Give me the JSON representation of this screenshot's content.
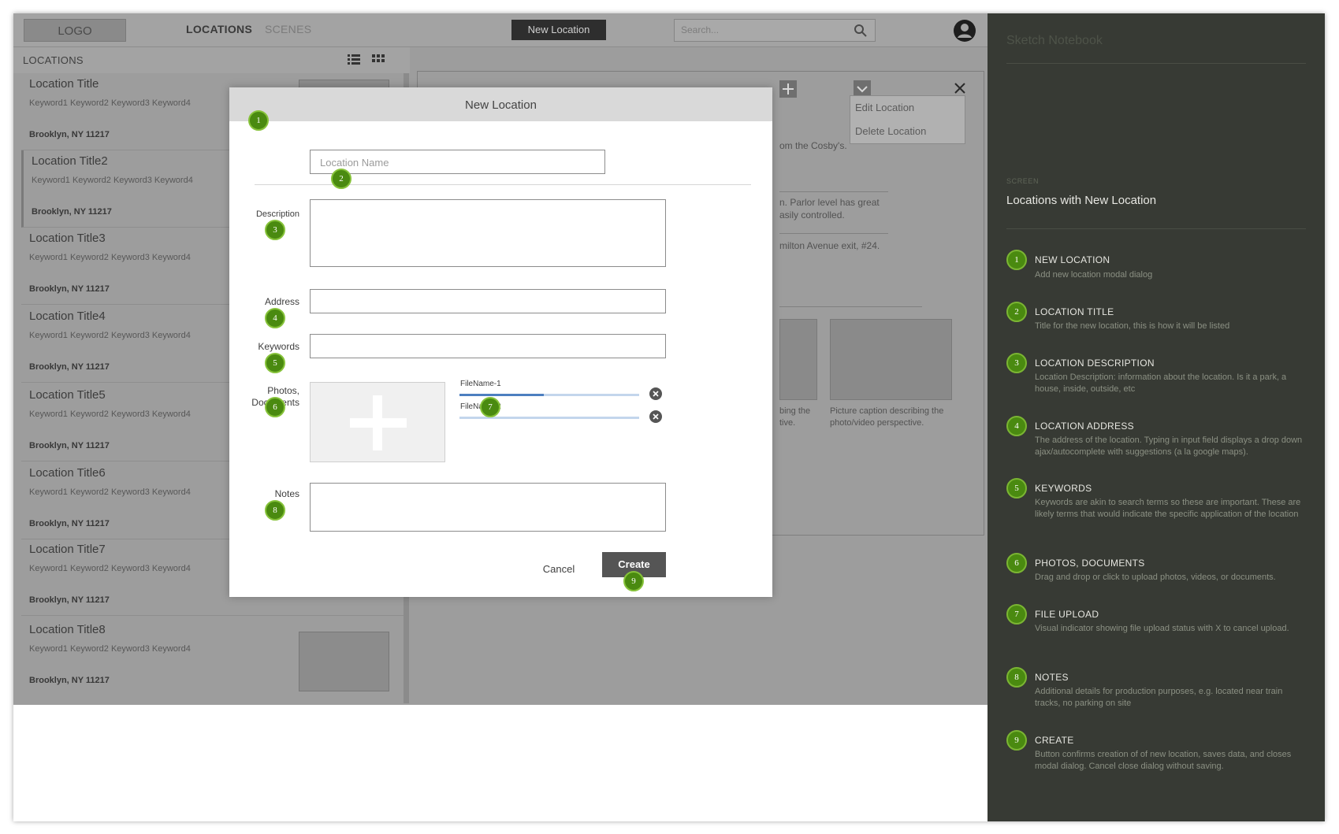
{
  "topbar": {
    "logo": "LOGO",
    "nav_locations": "LOCATIONS",
    "nav_scenes": "SCENES",
    "new_location_button": "New Location",
    "search_placeholder": "Search..."
  },
  "list": {
    "header": "LOCATIONS",
    "items": [
      {
        "title": "Location Title",
        "keywords": "Keyword1 Keyword2 Keyword3 Keyword4",
        "address": "Brooklyn, NY 11217"
      },
      {
        "title": "Location Title2",
        "keywords": "Keyword1 Keyword2 Keyword3 Keyword4",
        "address": "Brooklyn, NY 11217"
      },
      {
        "title": "Location Title3",
        "keywords": "Keyword1 Keyword2 Keyword3 Keyword4",
        "address": "Brooklyn, NY 11217"
      },
      {
        "title": "Location Title4",
        "keywords": "Keyword1 Keyword2 Keyword3 Keyword4",
        "address": "Brooklyn, NY 11217"
      },
      {
        "title": "Location Title5",
        "keywords": "Keyword1 Keyword2 Keyword3 Keyword4",
        "address": "Brooklyn, NY 11217"
      },
      {
        "title": "Location Title6",
        "keywords": "Keyword1 Keyword2 Keyword3 Keyword4",
        "address": "Brooklyn, NY 11217"
      },
      {
        "title": "Location Title7",
        "keywords": "Keyword1 Keyword2 Keyword3 Keyword4",
        "address": "Brooklyn, NY 11217"
      },
      {
        "title": "Location Title8",
        "keywords": "Keyword1 Keyword2 Keyword3 Keyword4",
        "address": "Brooklyn, NY 11217"
      }
    ]
  },
  "detail": {
    "text_1": "om the Cosby's.",
    "text_2": "n. Parlor level has great",
    "text_3": "asily controlled.",
    "text_4": "milton Avenue exit, #24.",
    "caption_left_1": "bing the",
    "caption_left_2": "tive.",
    "caption_right_1": "Picture caption describing the",
    "caption_right_2": "photo/video perspective."
  },
  "dropdown": {
    "edit": "Edit Location",
    "delete": "Delete Location"
  },
  "modal": {
    "title": "New Location",
    "name_placeholder": "Location Name",
    "description_label": "Description",
    "address_label": "Address",
    "keywords_label": "Keywords",
    "photos_label_1": "Photos,",
    "photos_label_2": "Documents",
    "notes_label": "Notes",
    "files": [
      {
        "name": "FileName-1",
        "progress": 0.47
      },
      {
        "name": "FileName-2",
        "progress": 0.0
      }
    ],
    "cancel": "Cancel",
    "create": "Create"
  },
  "badges": [
    "1",
    "2",
    "3",
    "4",
    "5",
    "6",
    "7",
    "8",
    "9"
  ],
  "notebook": {
    "title": "Sketch Notebook",
    "screen_label": "SCREEN",
    "screen_title": "Locations with New Location",
    "items": [
      {
        "num": "1",
        "title": "NEW LOCATION",
        "desc": "Add new location modal dialog"
      },
      {
        "num": "2",
        "title": "LOCATION TITLE",
        "desc": "Title for the new location, this is how it will be listed"
      },
      {
        "num": "3",
        "title": "LOCATION DESCRIPTION",
        "desc": "Location Description: information about the location.  Is it a park, a house, inside, outside, etc"
      },
      {
        "num": "4",
        "title": "LOCATION ADDRESS",
        "desc": "The address of the location.  Typing in input field displays a drop down ajax/autocomplete with suggestions (a la google maps)."
      },
      {
        "num": "5",
        "title": "KEYWORDS",
        "desc": "Keywords are akin to search terms so these are important.  These are likely terms that would indicate the specific application of the location"
      },
      {
        "num": "6",
        "title": "PHOTOS, DOCUMENTS",
        "desc": "Drag and drop or click to upload photos, videos, or documents."
      },
      {
        "num": "7",
        "title": "FILE UPLOAD",
        "desc": "Visual indicator showing file upload status with X to cancel upload."
      },
      {
        "num": "8",
        "title": "NOTES",
        "desc": "Additional details for production purposes, e.g. located near train tracks, no parking on site"
      },
      {
        "num": "9",
        "title": "CREATE",
        "desc": "Button confirms creation of of new location, saves data, and closes modal dialog.  Cancel close dialog without saving."
      }
    ]
  },
  "colors": {
    "badge": "#4a8a10",
    "notebook_bg": "#373a34",
    "progress": "#4d7fc0"
  }
}
